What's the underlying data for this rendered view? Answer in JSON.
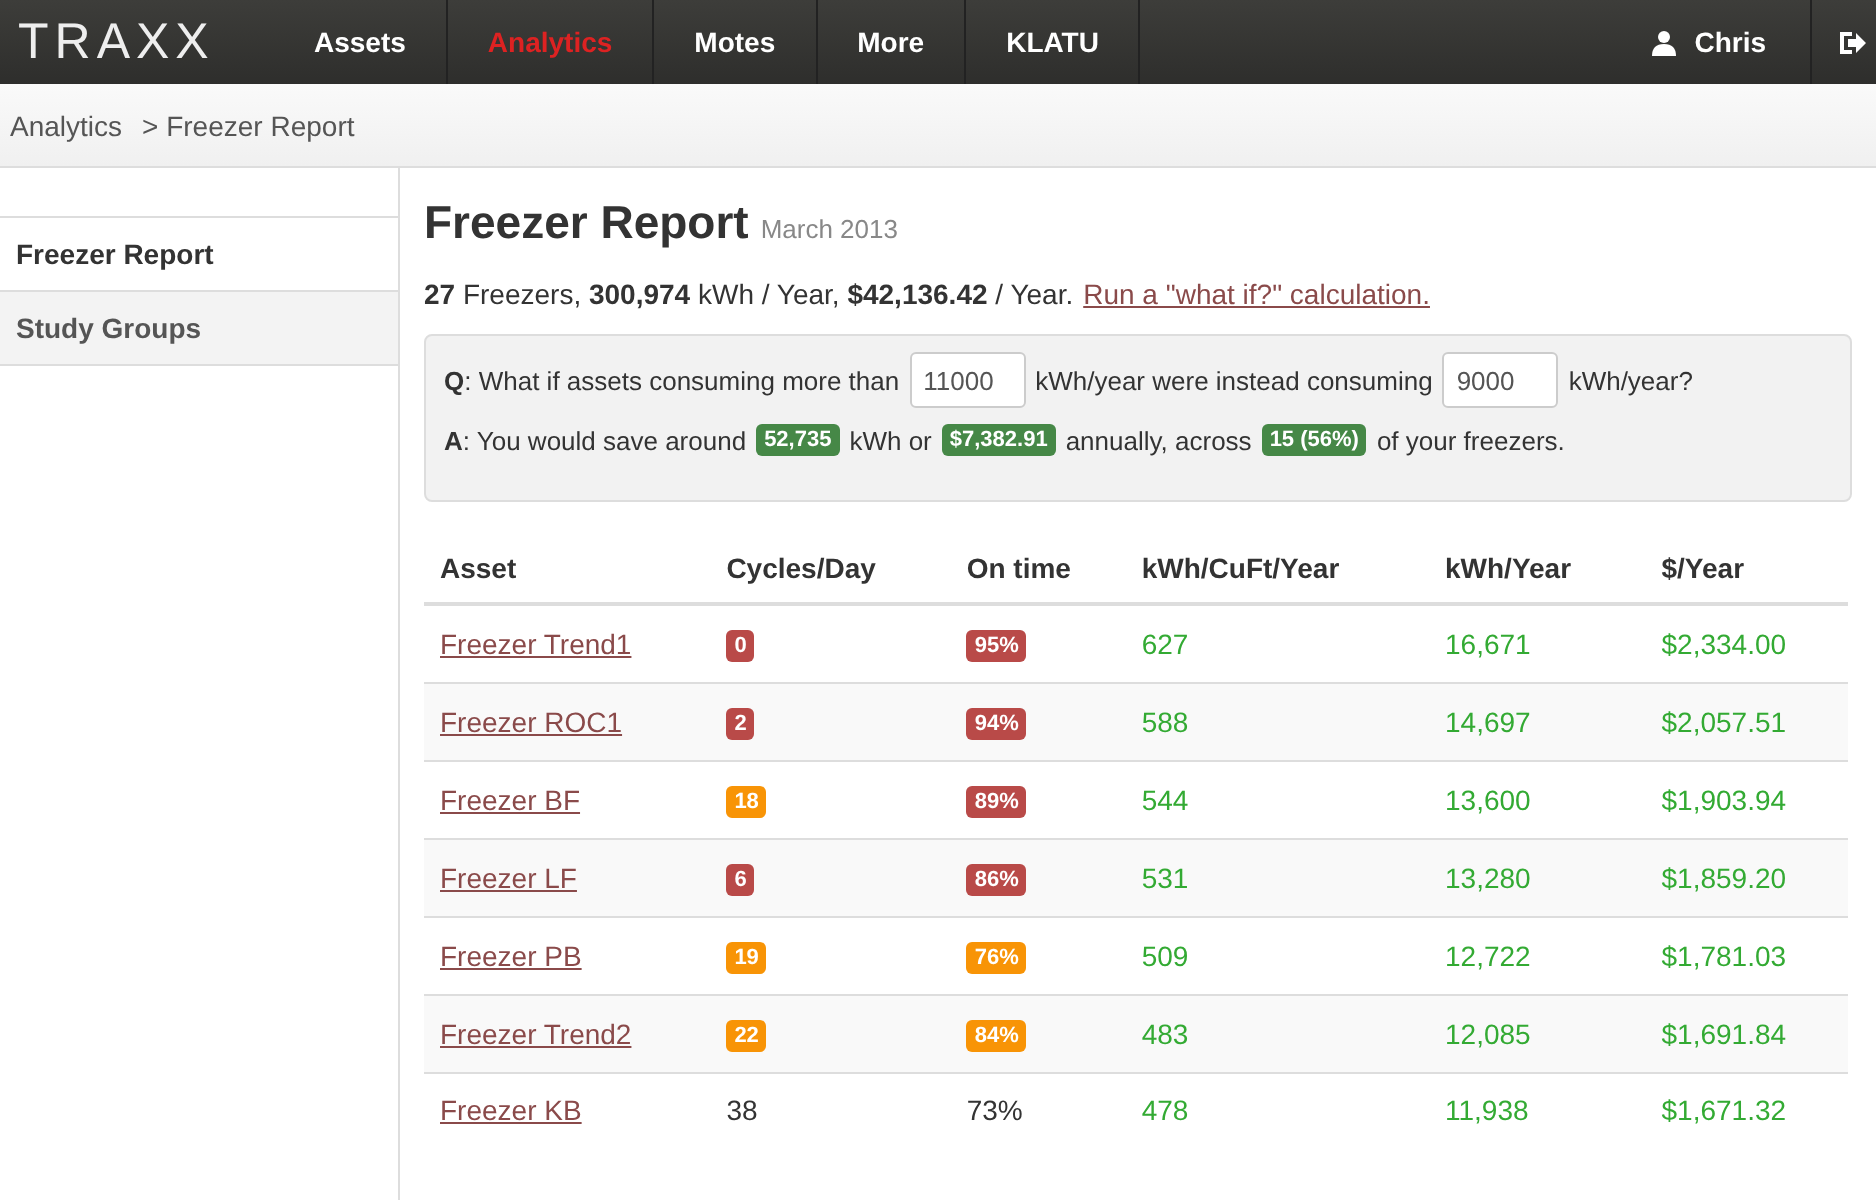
{
  "navbar": {
    "brand": "TRAXX",
    "items": [
      {
        "label": "Assets",
        "selected": false
      },
      {
        "label": "Analytics",
        "selected": true
      },
      {
        "label": "Motes",
        "selected": false
      },
      {
        "label": "More",
        "selected": false
      },
      {
        "label": "KLATU",
        "selected": false
      }
    ],
    "user": "Chris"
  },
  "breadcrumb": [
    "Analytics",
    "> Freezer Report"
  ],
  "sidebar": {
    "items": [
      {
        "label": "Freezer Report",
        "selected": true
      },
      {
        "label": "Study Groups",
        "selected": false
      }
    ]
  },
  "report": {
    "title": "Freezer Report",
    "subtitle": "March 2013",
    "summary": "**27** Freezers, **300,974** kWh / Year, **$42,136.42** / Year.",
    "summary_link": "Run a \"what if?\" calculation.",
    "question": {
      "label": "Q",
      "before": ": What if assets consuming more than",
      "threshold": "11000",
      "middle": "kWh/year were instead consuming",
      "target": "9000",
      "after": "kWh/year?"
    },
    "answer": {
      "label": "A",
      "before": ": You would save around",
      "kwh": "52,735",
      "middle": "kWh or",
      "dollars": "$7,382.91",
      "middle2": "annually, across",
      "count": "15 (56%)",
      "after": "of your freezers."
    }
  },
  "table": {
    "columns": [
      "Asset",
      "Cycles/Day",
      "On time",
      "kWh/CuFt/Year",
      "kWh/Year",
      "$/Year"
    ],
    "rows": [
      {
        "asset": "Freezer Trend1",
        "cycles": {
          "text": "0",
          "kind": "danger"
        },
        "on_time": {
          "text": "95%",
          "kind": "danger"
        },
        "kwh_cuft": "627",
        "kwh": "16,671",
        "cost": "$2,334.00"
      },
      {
        "asset": "Freezer ROC1",
        "cycles": {
          "text": "2",
          "kind": "danger"
        },
        "on_time": {
          "text": "94%",
          "kind": "danger"
        },
        "kwh_cuft": "588",
        "kwh": "14,697",
        "cost": "$2,057.51"
      },
      {
        "asset": "Freezer BF",
        "cycles": {
          "text": "18",
          "kind": "warning"
        },
        "on_time": {
          "text": "89%",
          "kind": "danger"
        },
        "kwh_cuft": "544",
        "kwh": "13,600",
        "cost": "$1,903.94"
      },
      {
        "asset": "Freezer LF",
        "cycles": {
          "text": "6",
          "kind": "danger"
        },
        "on_time": {
          "text": "86%",
          "kind": "danger"
        },
        "kwh_cuft": "531",
        "kwh": "13,280",
        "cost": "$1,859.20"
      },
      {
        "asset": "Freezer PB",
        "cycles": {
          "text": "19",
          "kind": "warning"
        },
        "on_time": {
          "text": "76%",
          "kind": "warning"
        },
        "kwh_cuft": "509",
        "kwh": "12,722",
        "cost": "$1,781.03"
      },
      {
        "asset": "Freezer Trend2",
        "cycles": {
          "text": "22",
          "kind": "warning"
        },
        "on_time": {
          "text": "84%",
          "kind": "warning"
        },
        "kwh_cuft": "483",
        "kwh": "12,085",
        "cost": "$1,691.84"
      },
      {
        "asset": "Freezer KB",
        "cycles": {
          "text": "38",
          "kind": "plain"
        },
        "on_time": {
          "text": "73%",
          "kind": "plain"
        },
        "kwh_cuft": "478",
        "kwh": "11,938",
        "cost": "$1,671.32"
      }
    ]
  }
}
